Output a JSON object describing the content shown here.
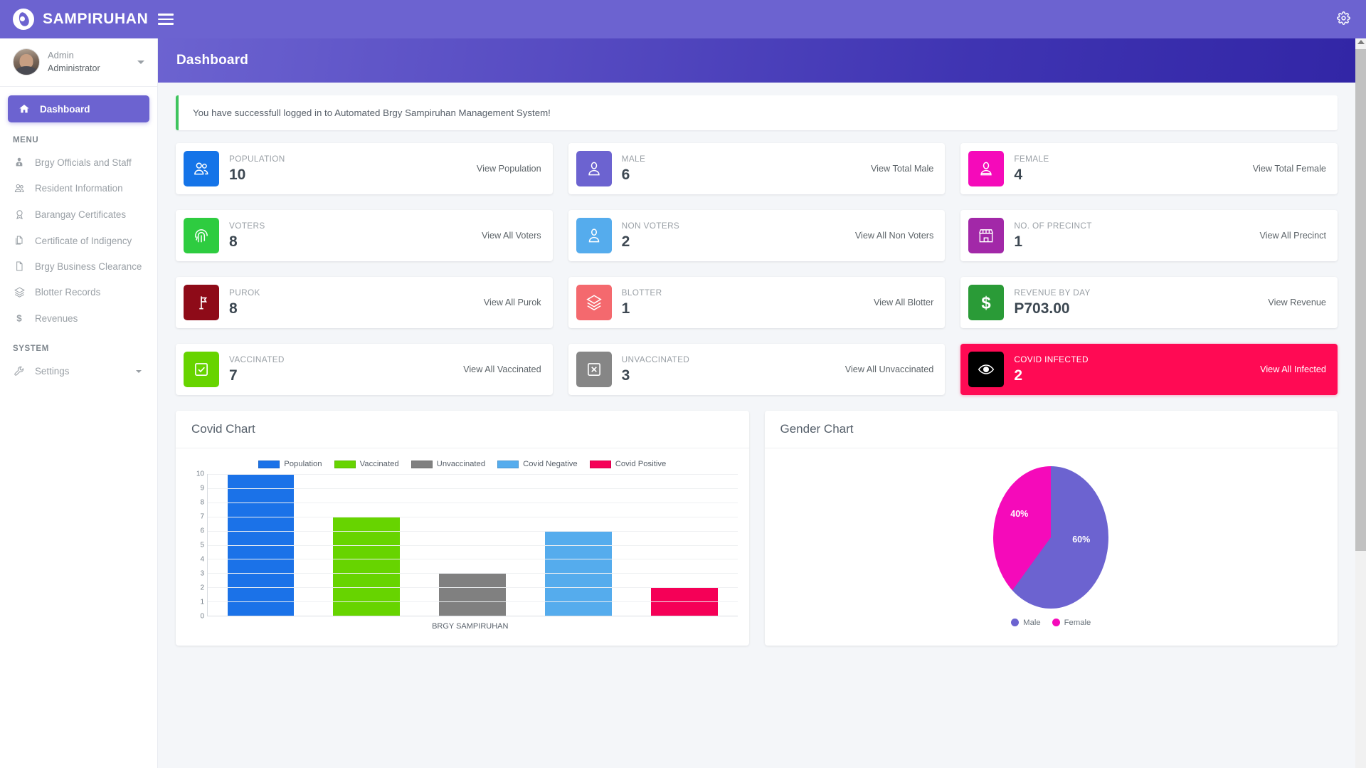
{
  "app": {
    "brand": "SAMPIRUHAN",
    "menu_toggle": "menu-toggle",
    "settings_icon": "⚙"
  },
  "user": {
    "name": "Admin",
    "role": "Administrator"
  },
  "sidebar": {
    "active_item": {
      "label": "Dashboard",
      "icon": "home-icon"
    },
    "menu_header": "MENU",
    "items": [
      {
        "label": "Brgy Officials and Staff",
        "icon": "user-tie-icon"
      },
      {
        "label": "Resident Information",
        "icon": "users-icon"
      },
      {
        "label": "Barangay Certificates",
        "icon": "certificate-icon"
      },
      {
        "label": "Certificate of Indigency",
        "icon": "copy-file-icon"
      },
      {
        "label": "Brgy Business Clearance",
        "icon": "file-icon"
      },
      {
        "label": "Blotter Records",
        "icon": "layers-icon"
      },
      {
        "label": "Revenues",
        "icon": "dollar-icon"
      }
    ],
    "system_header": "SYSTEM",
    "system_items": [
      {
        "label": "Settings",
        "icon": "wrench-icon",
        "has_caret": true
      }
    ]
  },
  "page": {
    "title": "Dashboard",
    "alert": "You have successfull logged in to Automated Brgy Sampiruhan Management System!"
  },
  "cards": [
    {
      "label": "POPULATION",
      "value": "10",
      "link": "View Population",
      "icon": "users-group-icon",
      "color": "#1574e8",
      "highlight": false
    },
    {
      "label": "MALE",
      "value": "6",
      "link": "View Total Male",
      "icon": "male-user-icon",
      "color": "#6c63d0",
      "highlight": false
    },
    {
      "label": "FEMALE",
      "value": "4",
      "link": "View Total Female",
      "icon": "female-user-icon",
      "color": "#f50aba",
      "highlight": false
    },
    {
      "label": "VOTERS",
      "value": "8",
      "link": "View All Voters",
      "icon": "fingerprint-icon",
      "color": "#2ecc40",
      "highlight": false
    },
    {
      "label": "NON VOTERS",
      "value": "2",
      "link": "View All Non Voters",
      "icon": "user-outline-icon",
      "color": "#55aced",
      "highlight": false
    },
    {
      "label": "NO. OF PRECINCT",
      "value": "1",
      "link": "View All Precinct",
      "icon": "store-icon",
      "color": "#a228a8",
      "highlight": false
    },
    {
      "label": "PUROK",
      "value": "8",
      "link": "View All Purok",
      "icon": "map-sign-icon",
      "color": "#8e0b18",
      "highlight": false
    },
    {
      "label": "BLOTTER",
      "value": "1",
      "link": "View All Blotter",
      "icon": "layers-icon",
      "color": "#f4696e",
      "highlight": false
    },
    {
      "label": "REVENUE BY DAY",
      "value": "P703.00",
      "link": "View Revenue",
      "icon": "dollar-icon",
      "color": "#2a9b37",
      "highlight": false
    },
    {
      "label": "VACCINATED",
      "value": "7",
      "link": "View All Vaccinated",
      "icon": "check-square-icon",
      "color": "#67d400",
      "highlight": false
    },
    {
      "label": "UNVACCINATED",
      "value": "3",
      "link": "View All Unvaccinated",
      "icon": "x-square-icon",
      "color": "#868686",
      "highlight": false
    },
    {
      "label": "COVID INFECTED",
      "value": "2",
      "link": "View All Infected",
      "icon": "eye-icon",
      "color": "#000000",
      "highlight": true
    }
  ],
  "panels": {
    "covid_title": "Covid Chart",
    "gender_title": "Gender Chart"
  },
  "chart_data": [
    {
      "type": "bar",
      "title": "Covid Chart",
      "categories": [
        "Population",
        "Vaccinated",
        "Unvaccinated",
        "Covid Negative",
        "Covid Positive"
      ],
      "values": [
        10,
        7,
        3,
        6,
        2
      ],
      "colors": [
        "#1b72e8",
        "#67d400",
        "#808080",
        "#55aced",
        "#f50057"
      ],
      "legend": [
        "Population",
        "Vaccinated",
        "Unvaccinated",
        "Covid Negative",
        "Covid Positive"
      ],
      "legend_position": "top",
      "xlabel": "BRGY SAMPIRUHAN",
      "ylabel": "",
      "ylim": [
        0,
        10
      ],
      "yticks": [
        0,
        1,
        2,
        3,
        4,
        5,
        6,
        7,
        8,
        9,
        10
      ],
      "grid": true
    },
    {
      "type": "pie",
      "title": "Gender Chart",
      "labels": [
        "Male",
        "Female"
      ],
      "values": [
        60,
        40
      ],
      "value_labels": [
        "60%",
        "40%"
      ],
      "colors": [
        "#6c63d0",
        "#f50aba"
      ],
      "legend_position": "bottom"
    }
  ]
}
